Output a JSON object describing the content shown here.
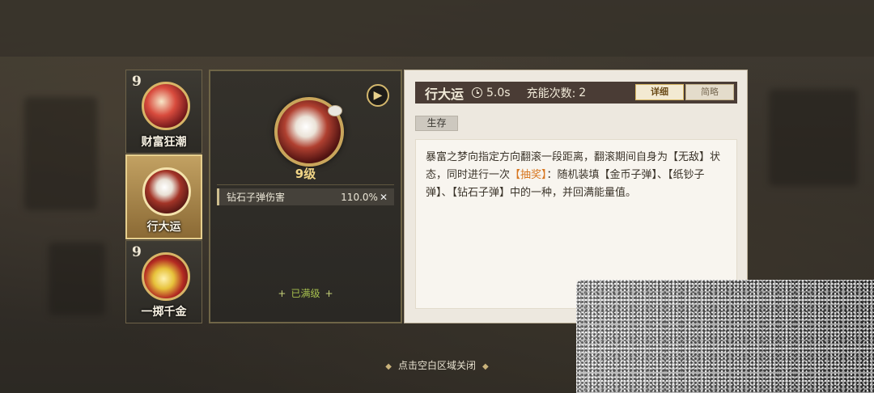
{
  "skills": [
    {
      "level": "9",
      "name": "财富狂潮",
      "icon": "fortune-coin-skill-icon",
      "selected": false
    },
    {
      "level": "",
      "name": "行大运",
      "icon": "lucky-rabbit-skill-icon",
      "selected": true
    },
    {
      "level": "9",
      "name": "一掷千金",
      "icon": "gold-coin-skill-icon",
      "selected": false
    }
  ],
  "detail": {
    "level_text": "9级",
    "stat_name": "钻石子弹伤害",
    "stat_value": "110.0%",
    "stat_symbol": "✕",
    "maxed_text": "已满级",
    "info_icon": "▶"
  },
  "skill_info": {
    "name": "行大运",
    "cooldown": "5.0s",
    "charge_label": "充能次数:",
    "charge_value": "2",
    "tab_detail": "详细",
    "tab_brief": "简略",
    "tag": "生存",
    "desc_part1": "暴富之梦向指定方向翻滚一段距离，翻滚期间自身为【无敌】状态，同时进行一次",
    "desc_highlight": "【抽奖】",
    "desc_part2": "：随机装填【金币子弹】、【纸钞子弹】、【钻石子弹】中的一种，并回满能量值。"
  },
  "close_hint": "点击空白区域关闭",
  "colors": {
    "accent_gold": "#d8b567",
    "highlight_orange": "#d7761f",
    "maxed_green": "#a7c14e",
    "header_brown": "#4a3c35"
  }
}
